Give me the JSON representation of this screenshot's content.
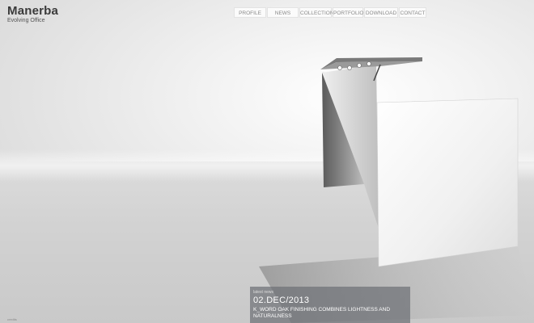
{
  "brand": {
    "name": "Manerba",
    "tagline": "Evolving Office"
  },
  "nav": {
    "items": [
      {
        "label": "PROFILE"
      },
      {
        "label": "NEWS"
      },
      {
        "label": "COLLECTION"
      },
      {
        "label": "PORTFOLIO"
      },
      {
        "label": "DOWNLOAD"
      },
      {
        "label": "CONTACT"
      }
    ]
  },
  "news": {
    "kicker": "latest news",
    "date": "02.DEC/2013",
    "title": "K_WORD OAK FINISHING COMBINES LIGHTNESS AND NATURALNESS"
  },
  "footer": {
    "text": "credits"
  }
}
